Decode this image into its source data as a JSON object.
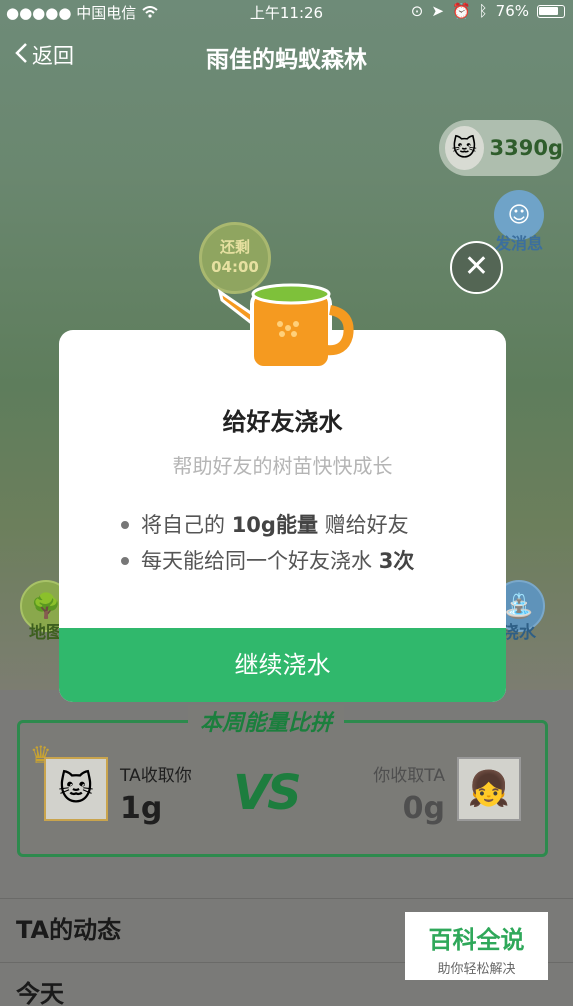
{
  "status_bar": {
    "carrier": "●●●●● 中国电信",
    "time": "上午11:26",
    "battery": "76%"
  },
  "nav": {
    "back_label": "返回",
    "title": "雨佳的蚂蚁森林"
  },
  "energy_badge": {
    "value": "3390g"
  },
  "message_button": {
    "label": "发消息"
  },
  "timer": {
    "label": "还剩",
    "value": "04:00"
  },
  "side_buttons": {
    "left_label": "地图",
    "right_label": "浇水"
  },
  "modal": {
    "title": "给好友浇水",
    "subtitle": "帮助好友的树苗快快成长",
    "bullet1_prefix": "将自己的 ",
    "bullet1_bold": "10g能量",
    "bullet1_suffix": " 赠给好友",
    "bullet2_prefix": "每天能给同一个好友浇水 ",
    "bullet2_bold": "3次",
    "action_label": "继续浇水"
  },
  "compare": {
    "title": "本周能量比拼",
    "ta_got_label": "TA收取你",
    "ta_got_value": "1g",
    "vs": "VS",
    "you_got_label": "你收取TA",
    "you_got_value": "0g"
  },
  "sections": {
    "dynamics": "TA的动态",
    "today": "今天"
  },
  "watermark": {
    "title": "百科全说",
    "subtitle": "助你轻松解决"
  }
}
